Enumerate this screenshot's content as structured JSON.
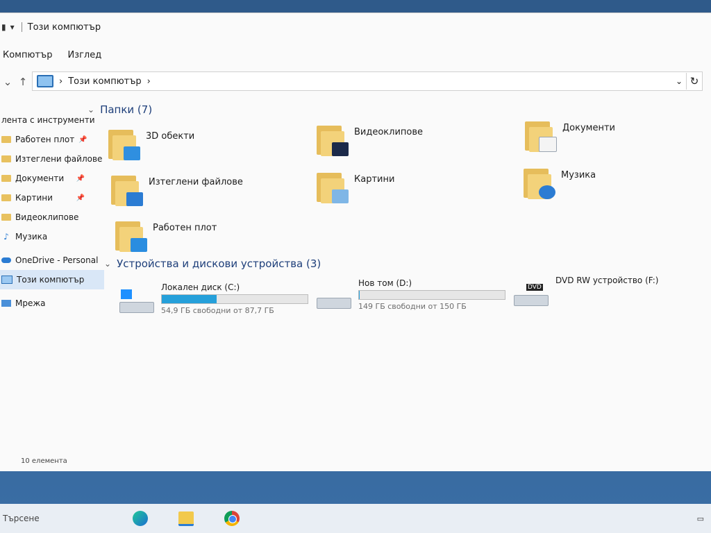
{
  "window": {
    "title": "Този компютър"
  },
  "ribbon": {
    "tabs": [
      "Компютър",
      "Изглед"
    ]
  },
  "address": {
    "breadcrumb": "Този компютър"
  },
  "navpane": {
    "items": [
      {
        "label": "лента с инструменти"
      },
      {
        "label": "Работен плот"
      },
      {
        "label": "Изтеглени файлове"
      },
      {
        "label": "Документи"
      },
      {
        "label": "Картини"
      },
      {
        "label": "Видеоклипове"
      },
      {
        "label": "Музика"
      },
      {
        "label": "OneDrive - Personal"
      },
      {
        "label": "Този компютър"
      },
      {
        "label": "Мрежа"
      }
    ]
  },
  "folders": {
    "header": "Папки (7)",
    "items": [
      {
        "name": "3D обекти",
        "icon": "cube-icon"
      },
      {
        "name": "Видеоклипове",
        "icon": "film-icon"
      },
      {
        "name": "Документи",
        "icon": "document-icon"
      },
      {
        "name": "Изтеглени файлове",
        "icon": "download-arrow-icon"
      },
      {
        "name": "Картини",
        "icon": "picture-icon"
      },
      {
        "name": "Музика",
        "icon": "music-note-icon"
      },
      {
        "name": "Работен плот",
        "icon": "desktop-icon"
      }
    ]
  },
  "drives": {
    "header": "Устройства и дискови устройства (3)",
    "items": [
      {
        "name": "Локален диск (C:)",
        "free": "54,9 ГБ свободни от 87,7 ГБ",
        "used_fraction": 0.374
      },
      {
        "name": "Нов том (D:)",
        "free": "149 ГБ свободни от 150 ГБ",
        "used_fraction": 0.007
      },
      {
        "name": "DVD RW устройство (F:)",
        "free": ""
      }
    ]
  },
  "status": {
    "count": "10 елемента"
  },
  "taskbar": {
    "search_label": "Търсене"
  }
}
